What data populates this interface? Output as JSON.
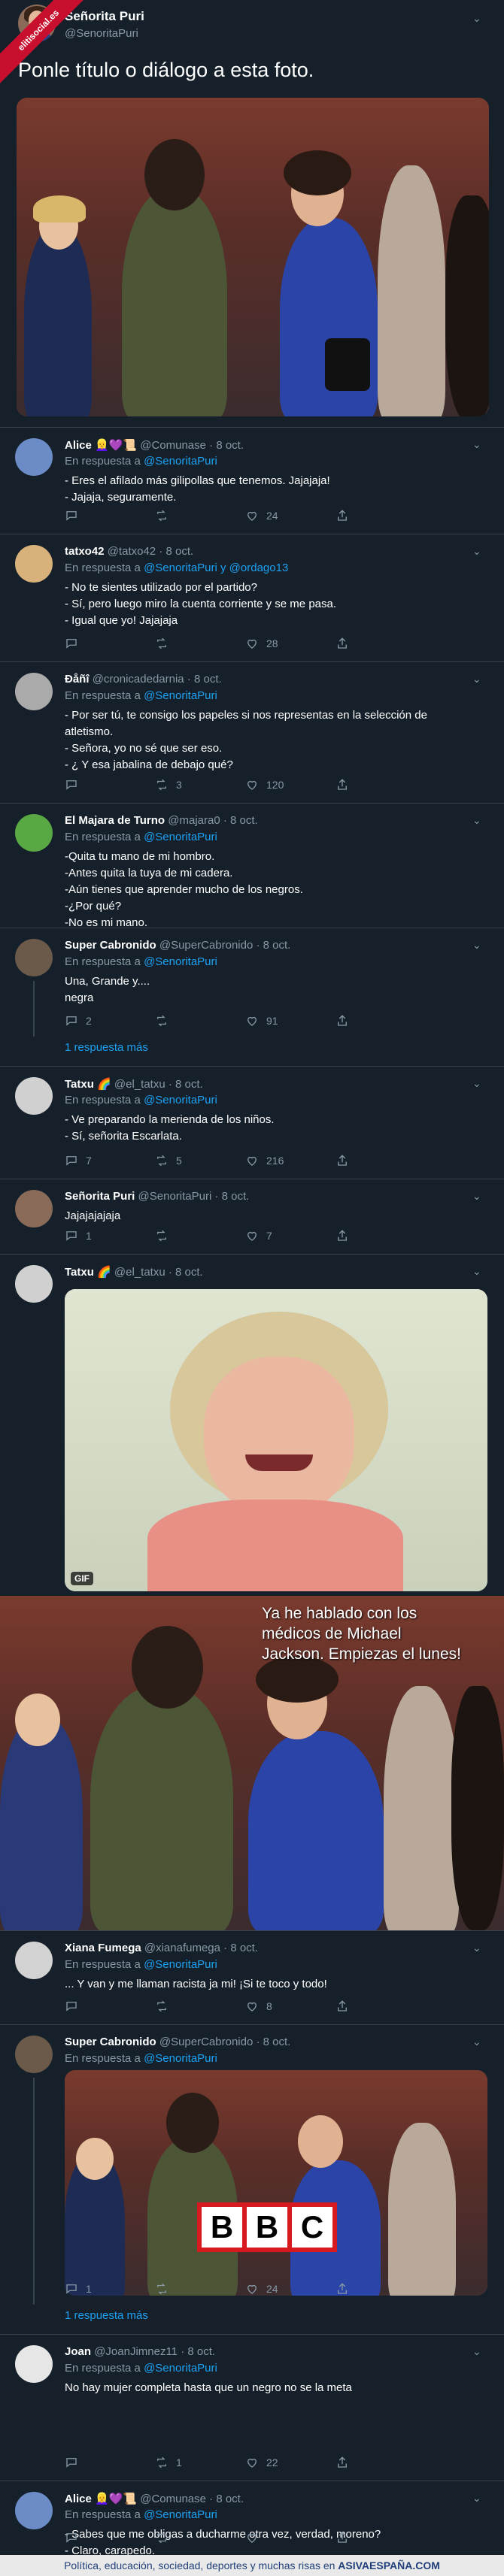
{
  "ribbon": {
    "text": "elitisocial.es"
  },
  "main": {
    "name": "Señorita Puri",
    "handle": "@SenoritaPuri",
    "text": "Ponle título o diálogo a esta foto."
  },
  "replies": [
    {
      "name": "Alice",
      "emoji": "👱‍♀️💜📜",
      "handle": "@Comunase",
      "date": "· 8 oct.",
      "resp_prefix": "En respuesta a",
      "resp_to": "@SenoritaPuri",
      "lines": [
        "- Eres el afilado más gilipollas que tenemos. Jajajaja!",
        "- Jajaja, seguramente."
      ],
      "replies": "",
      "rts": "",
      "likes": "24"
    },
    {
      "name": "tatxo42",
      "emoji": "",
      "handle": "@tatxo42",
      "date": "· 8 oct.",
      "resp_prefix": "En respuesta a",
      "resp_to": "@SenoritaPuri y @ordago13",
      "lines": [
        "- No te sientes utilizado por el partido?",
        "- Sí, pero luego miro la cuenta corriente y se me pasa.",
        "- Igual que yo! Jajajaja"
      ],
      "replies": "",
      "rts": "",
      "likes": "28"
    },
    {
      "name": "Ðåñî",
      "emoji": "",
      "handle": "@cronicadedarnia",
      "date": "· 8 oct.",
      "resp_prefix": "En respuesta a",
      "resp_to": "@SenoritaPuri",
      "lines": [
        "- Por ser tú, te consigo los papeles si nos representas en la selección de",
        "atletismo.",
        "- Señora, yo no sé que ser eso.",
        "- ¿ Y esa jabalina de debajo qué?"
      ],
      "replies": "",
      "rts": "3",
      "likes": "120"
    },
    {
      "name": "El Majara de Turno",
      "emoji": "",
      "handle": "@majara0",
      "date": "· 8 oct.",
      "resp_prefix": "En respuesta a",
      "resp_to": "@SenoritaPuri",
      "lines": [
        "-Quita tu mano de mi hombro.",
        "-Antes quita la tuya de mi cadera.",
        "-Aún tienes que aprender mucho de los negros.",
        "-¿Por qué?",
        "-No es mi mano."
      ],
      "replies": "",
      "rts": "",
      "likes": ""
    },
    {
      "name": "Super Cabronido",
      "emoji": "",
      "handle": "@SuperCabronido",
      "date": "· 8 oct.",
      "resp_prefix": "En respuesta a",
      "resp_to": "@SenoritaPuri",
      "lines": [
        "Una, Grande y....",
        "negra"
      ],
      "replies": "2",
      "rts": "",
      "likes": "91",
      "more": "1 respuesta más"
    },
    {
      "name": "Tatxu",
      "emoji": "🌈",
      "handle": "@el_tatxu",
      "date": "· 8 oct.",
      "resp_prefix": "En respuesta a",
      "resp_to": "@SenoritaPuri",
      "lines": [
        "- Ve preparando la merienda de los niños.",
        "- Sí, señorita Escarlata."
      ],
      "replies": "7",
      "rts": "5",
      "likes": "216"
    },
    {
      "name": "Señorita Puri",
      "emoji": "",
      "handle": "@SenoritaPuri",
      "date": "· 8 oct.",
      "resp_prefix": "",
      "resp_to": "",
      "lines": [
        "Jajajajajaja"
      ],
      "replies": "1",
      "rts": "",
      "likes": "7"
    },
    {
      "name": "Tatxu",
      "emoji": "🌈",
      "handle": "@el_tatxu",
      "date": "· 8 oct.",
      "resp_prefix": "",
      "resp_to": "",
      "lines": [],
      "replies": "",
      "rts": "",
      "likes": "",
      "gif": "GIF"
    },
    {
      "name": "Xiana Fumega",
      "emoji": "",
      "handle": "@xianafumega",
      "date": "· 8 oct.",
      "resp_prefix": "En respuesta a",
      "resp_to": "@SenoritaPuri",
      "lines": [
        "... Y van y me llaman racista ja mi! ¡Si te toco y todo!"
      ],
      "replies": "",
      "rts": "",
      "likes": "8"
    },
    {
      "name": "Super Cabronido",
      "emoji": "",
      "handle": "@SuperCabronido",
      "date": "· 8 oct.",
      "resp_prefix": "En respuesta a",
      "resp_to": "@SenoritaPuri",
      "lines": [],
      "replies": "1",
      "rts": "",
      "likes": "24",
      "more": "1 respuesta más"
    },
    {
      "name": "Joan",
      "emoji": "",
      "handle": "@JoanJimnez11",
      "date": "· 8 oct.",
      "resp_prefix": "En respuesta a",
      "resp_to": "@SenoritaPuri",
      "lines": [
        "No hay mujer completa hasta que un negro no se la meta"
      ],
      "replies": "",
      "rts": "1",
      "likes": "22"
    },
    {
      "name": "Alice",
      "emoji": "👱‍♀️💜📜",
      "handle": "@Comunase",
      "date": "· 8 oct.",
      "resp_prefix": "En respuesta a",
      "resp_to": "@SenoritaPuri",
      "lines": [
        "- Sabes que me obligas a ducharme otra vez, verdad, moreno?",
        "- Claro, carapedo."
      ],
      "replies": "",
      "rts": "",
      "likes": ""
    }
  ],
  "meme_caption": [
    "Ya he hablado con los",
    "médicos de Michael",
    "Jackson. Empiezas el lunes!"
  ],
  "bbc_letters": [
    "B",
    "B",
    "C"
  ],
  "footer": {
    "text": "Política, educación, sociedad, deportes y muchas risas en",
    "brand": "ASIVAESPAÑA.COM"
  },
  "colors": {
    "bg": "#15202b",
    "accent": "#1da1f2",
    "muted": "#8899a6",
    "border": "#38444d"
  }
}
